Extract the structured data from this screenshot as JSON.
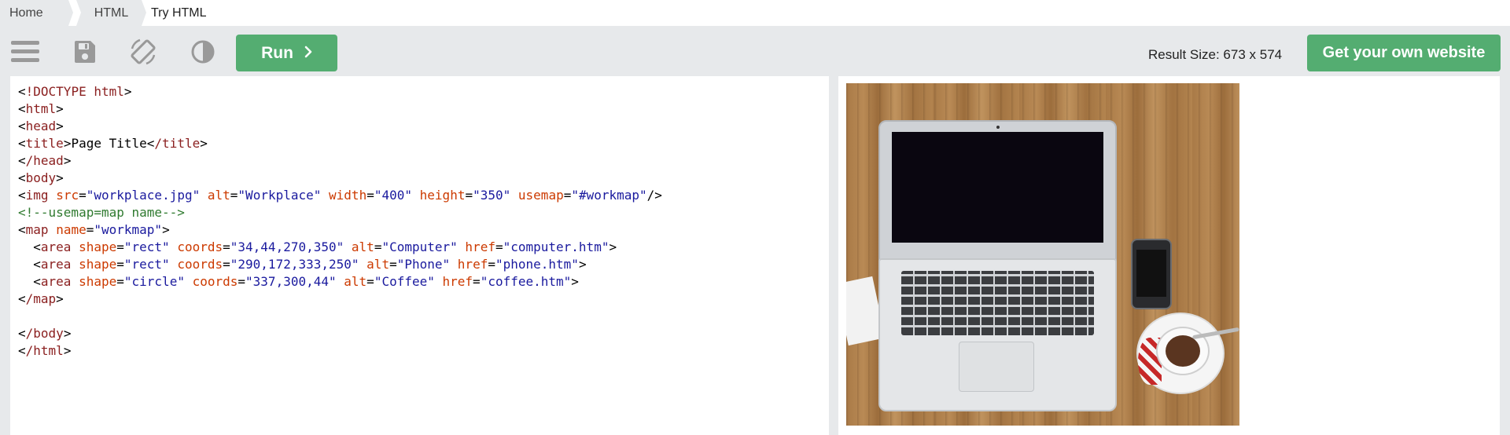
{
  "breadcrumb": {
    "home": "Home",
    "html": "HTML",
    "current": "Try HTML"
  },
  "toolbar": {
    "icons": [
      "menu-icon",
      "save-icon",
      "rotate-icon",
      "contrast-icon"
    ],
    "run_label": "Run",
    "result_size": "Result Size: 673 x 574",
    "get_website_label": "Get your own website",
    "accent_color": "#54ad71"
  },
  "editor": {
    "lines": [
      "<!DOCTYPE html>",
      "<html>",
      "<head>",
      "<title>Page Title</title>",
      "</head>",
      "<body>",
      "<img src=\"workplace.jpg\" alt=\"Workplace\" width=\"400\" height=\"350\" usemap=\"#workmap\"/>",
      "<!--usemap=map name-->",
      "<map name=\"workmap\">",
      "  <area shape=\"rect\" coords=\"34,44,270,350\" alt=\"Computer\" href=\"computer.htm\">",
      "  <area shape=\"rect\" coords=\"290,172,333,250\" alt=\"Phone\" href=\"phone.htm\">",
      "  <area shape=\"circle\" coords=\"337,300,44\" alt=\"Coffee\" href=\"coffee.htm\">",
      "</map>",
      "",
      "</body>",
      "</html>"
    ]
  },
  "result": {
    "image": "workplace-photo"
  }
}
